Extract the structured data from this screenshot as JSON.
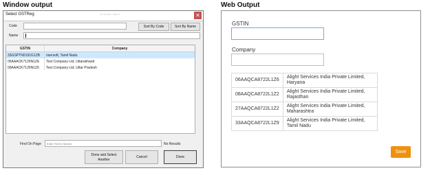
{
  "window_output": {
    "heading": "Window output",
    "dialog_title": "Select GSTReg",
    "ghost_title": "Do Action Taken",
    "close_glyph": "✕",
    "code_label": "Code",
    "code_value": "",
    "name_label": "Name",
    "name_value": "",
    "sort_by_code": "Sort By Code",
    "sort_by_name": "Sort By Name",
    "columns": [
      "GSTIN",
      "Company"
    ],
    "rows": [
      {
        "gstin": "33GSPTN0191G1ZB",
        "company": "risersoft, Tamil Nadu"
      },
      {
        "gstin": "05AAACK7126N1ZE",
        "company": "Test Company Ltd, Uttarakhand"
      },
      {
        "gstin": "09AAACK7126N1Z6",
        "company": "Test Company Ltd, Uttar Pradesh"
      }
    ],
    "find_label": "Find On Page",
    "find_placeholder": "Enter Text to Search",
    "find_result": "No Results",
    "done_select_another": "Done and Select Another",
    "cancel": "Cancel",
    "done": "Done"
  },
  "web_output": {
    "heading": "Web Output",
    "gstin_label": "GSTIN",
    "gstin_value": "",
    "company_label": "Company",
    "company_value": "",
    "rows": [
      {
        "gstin": "06AAQCA8722L1Z6",
        "company": "Alight Services India Private Limited, Haryana"
      },
      {
        "gstin": "08AAQCA8722L1Z2",
        "company": "Alight Services India Private Limited, Rajasthan"
      },
      {
        "gstin": "27AAQCA8722L1Z2",
        "company": "Alight Services India Private Limited, Maharashtra"
      },
      {
        "gstin": "33AAQCA8722L1Z9",
        "company": "Alight Services India Private Limited, Tamil Nadu"
      }
    ],
    "save": "Save"
  },
  "colors": {
    "selected_row": "#cce8ff",
    "close_button": "#c75050",
    "save_button": "#f0900f"
  }
}
